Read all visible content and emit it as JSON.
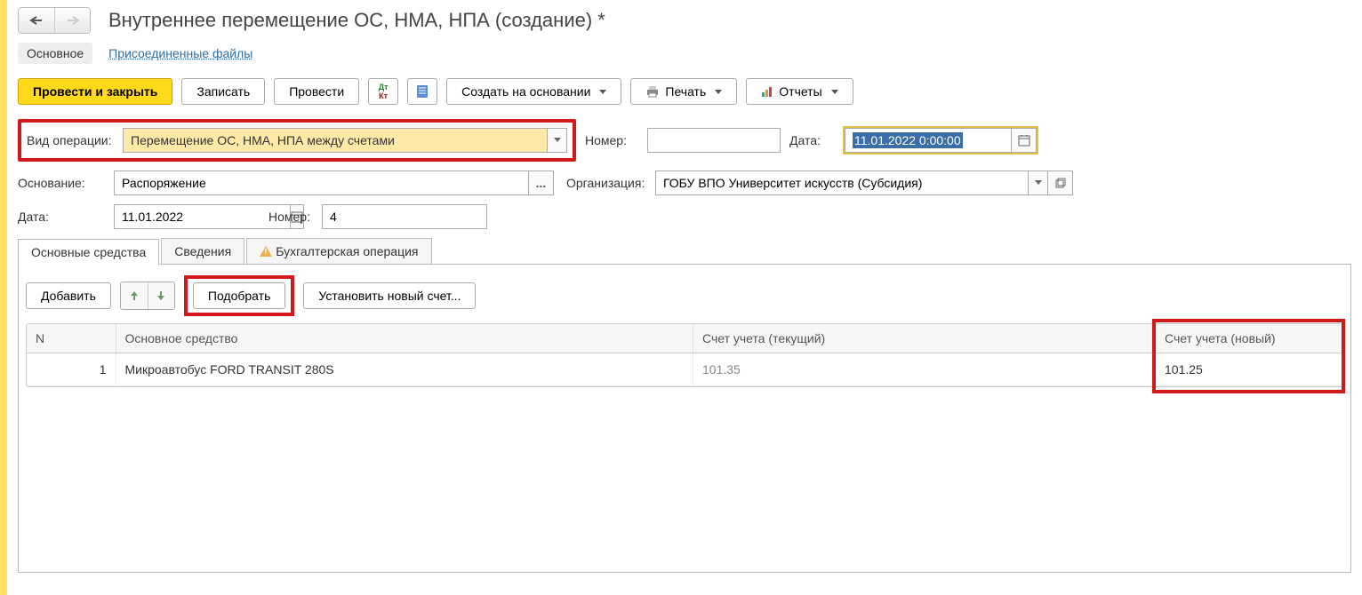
{
  "header": {
    "title": "Внутреннее перемещение ОС, НМА, НПА (создание) *"
  },
  "top_tabs": {
    "main": "Основное",
    "files": "Присоединенные файлы"
  },
  "toolbar": {
    "post_close": "Провести и закрыть",
    "save": "Записать",
    "post": "Провести",
    "create_from": "Создать на основании",
    "print": "Печать",
    "reports": "Отчеты"
  },
  "form": {
    "op_type_label": "Вид операции:",
    "op_type_value": "Перемещение ОС, НМА, НПА между счетами",
    "number_label": "Номер:",
    "number_value": "",
    "date_label": "Дата:",
    "date_value": "11.01.2022  0:00:00",
    "basis_label": "Основание:",
    "basis_value": "Распоряжение",
    "org_label": "Организация:",
    "org_value": "ГОБУ ВПО Университет искусств (Субсидия)",
    "date2_label": "Дата:",
    "date2_value": "11.01.2022",
    "number2_label": "Номер:",
    "number2_value": "4"
  },
  "tabs": {
    "assets": "Основные средства",
    "info": "Сведения",
    "acc_op": "Бухгалтерская операция"
  },
  "table_toolbar": {
    "add": "Добавить",
    "pick": "Подобрать",
    "set_new_account": "Установить новый счет..."
  },
  "table": {
    "headers": {
      "n": "N",
      "asset": "Основное средство",
      "acc_current": "Счет учета (текущий)",
      "acc_new": "Счет учета (новый)"
    },
    "rows": [
      {
        "n": "1",
        "asset": "Микроавтобус FORD TRANSIT 280S",
        "acc_current": "101.35",
        "acc_new": "101.25"
      }
    ]
  }
}
